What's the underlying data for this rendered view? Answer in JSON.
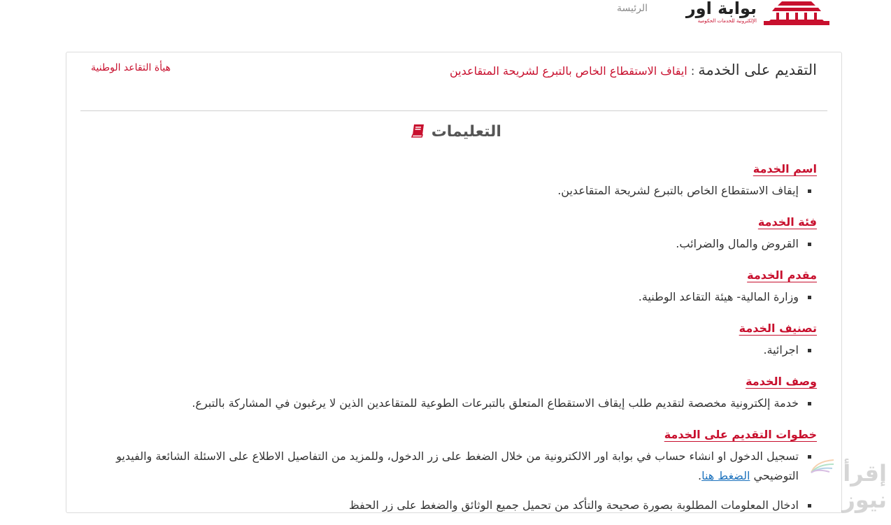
{
  "header": {
    "logo_title": "بوابة اور",
    "logo_subtitle": "الإلكترونية للخدمات الحكومية",
    "home_link": "الرئيسة",
    "logo_icon": "building-columns-icon",
    "brand_color": "#c8102e"
  },
  "panel": {
    "apply_label": "التقديم على الخدمة",
    "colon": ":",
    "service_title": "ايقاف الاستقطاع الخاص بالتبرع لشريحة المتقاعدين",
    "authority_link": "هيأة التقاعد الوطنية",
    "instructions_title": "التعليمات",
    "instructions_icon": "book-icon"
  },
  "sections": [
    {
      "heading": "اسم الخدمة",
      "items": [
        "إيقاف الاستقطاع الخاص بالتبرع لشريحة المتقاعدين."
      ]
    },
    {
      "heading": "فئة الخدمة",
      "items": [
        "القروض والمال والضرائب."
      ]
    },
    {
      "heading": "مقدم الخدمة",
      "items": [
        "وزارة المالية- هيئة التقاعد الوطنية."
      ]
    },
    {
      "heading": "تصنيف الخدمة",
      "items": [
        "اجرائية."
      ]
    },
    {
      "heading": "وصف الخدمة",
      "items": [
        "خدمة إلكترونية مخصصة لتقديم طلب إيقاف الاستقطاع المتعلق بالتبرعات الطوعية للمتقاعدين الذين لا يرغبون في المشاركة بالتبرع."
      ]
    }
  ],
  "steps": {
    "heading": "خطوات التقديم على الخدمة",
    "step1_text": "تسجيل الدخول او انشاء حساب في بوابة اور الالكترونية من خلال الضغط على زر الدخول، وللمزيد من التفاصيل الاطلاع على الاسئلة الشائعة والفيديو التوضيحي",
    "step1_link": "الضغط هنا",
    "step1_end": ".",
    "step2_text": "ادخال المعلومات المطلوبة بصورة صحيحة والتأكد من تحميل جميع الوثائق والضغط على زر الحفظ"
  },
  "watermark": {
    "text": "إقرأ نيوز",
    "icon": "feather-fan-icon"
  }
}
